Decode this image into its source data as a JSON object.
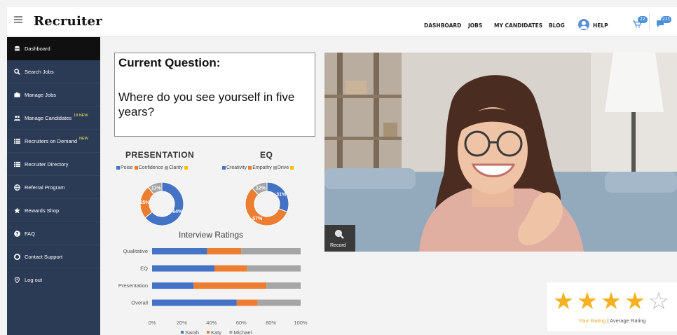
{
  "app": {
    "brand": "Recruiter"
  },
  "nav": {
    "dashboard": "DASHBOARD",
    "jobs": "JOBS",
    "my_candidates": "MY CANDIDATES",
    "blog": "BLOG",
    "help": "HELP",
    "cart_count": "22",
    "messages_count": "211"
  },
  "sidebar": {
    "items": [
      {
        "label": "Dashboard",
        "icon": "dashboard-icon",
        "badge": ""
      },
      {
        "label": "Search Jobs",
        "icon": "search-icon",
        "badge": ""
      },
      {
        "label": "Manage Jobs",
        "icon": "briefcase-icon",
        "badge": ""
      },
      {
        "label": "Manage Candidates",
        "icon": "users-icon",
        "badge": "18 NEW"
      },
      {
        "label": "Recruiters on Demand",
        "icon": "list-icon",
        "badge": "NEW"
      },
      {
        "label": "Recruiter Directory",
        "icon": "list-icon",
        "badge": ""
      },
      {
        "label": "Referral Program",
        "icon": "globe-icon",
        "badge": ""
      },
      {
        "label": "Rewards Shop",
        "icon": "star-icon",
        "badge": ""
      },
      {
        "label": "FAQ",
        "icon": "question-icon",
        "badge": ""
      },
      {
        "label": "Contact Support",
        "icon": "lifebuoy-icon",
        "badge": ""
      },
      {
        "label": "Log out",
        "icon": "location-icon",
        "badge": ""
      }
    ]
  },
  "question": {
    "heading": "Current Question:",
    "text": "Where do you see yourself in five years?"
  },
  "colors": {
    "blue": "#4472c4",
    "orange": "#ed7d31",
    "gray": "#a5a5a5",
    "yellow": "#ffc000",
    "sidebar": "#2b3a55",
    "star": "#f4b223"
  },
  "chart_data": [
    {
      "type": "pie",
      "title": "PRESENTATION",
      "labels": [
        "Poise",
        "Confidence",
        "Clarity",
        ""
      ],
      "values": [
        64,
        25,
        11,
        0
      ],
      "value_labels": [
        "64%",
        "25%",
        "11%"
      ],
      "legend": "top"
    },
    {
      "type": "pie",
      "title": "EQ",
      "labels": [
        "Creativity",
        "Empathy",
        "Drive",
        ""
      ],
      "values": [
        31,
        57,
        12,
        0
      ],
      "value_labels": [
        "31%",
        "57%",
        "12%"
      ],
      "legend": "top"
    },
    {
      "type": "bar",
      "orientation": "horizontal",
      "stacked": true,
      "title": "Interview Ratings",
      "categories": [
        "Qualitative",
        "EQ",
        "Presentation",
        "Overall"
      ],
      "series": [
        {
          "name": "Sarah",
          "values": [
            37,
            42,
            28,
            57
          ]
        },
        {
          "name": "Katy",
          "values": [
            23,
            22,
            49,
            14
          ]
        },
        {
          "name": "Michael",
          "values": [
            40,
            36,
            23,
            29
          ]
        }
      ],
      "xlim": [
        0,
        100
      ],
      "xticks": [
        "0%",
        "20%",
        "40%",
        "60%",
        "80%",
        "100%"
      ],
      "legend": "bottom",
      "grid": false
    }
  ],
  "video": {
    "record_label": "Record"
  },
  "rating": {
    "stars": 4,
    "max": 5,
    "your_rating": "Your Rating",
    "separator": "|",
    "average_rating": "Average Rating"
  }
}
